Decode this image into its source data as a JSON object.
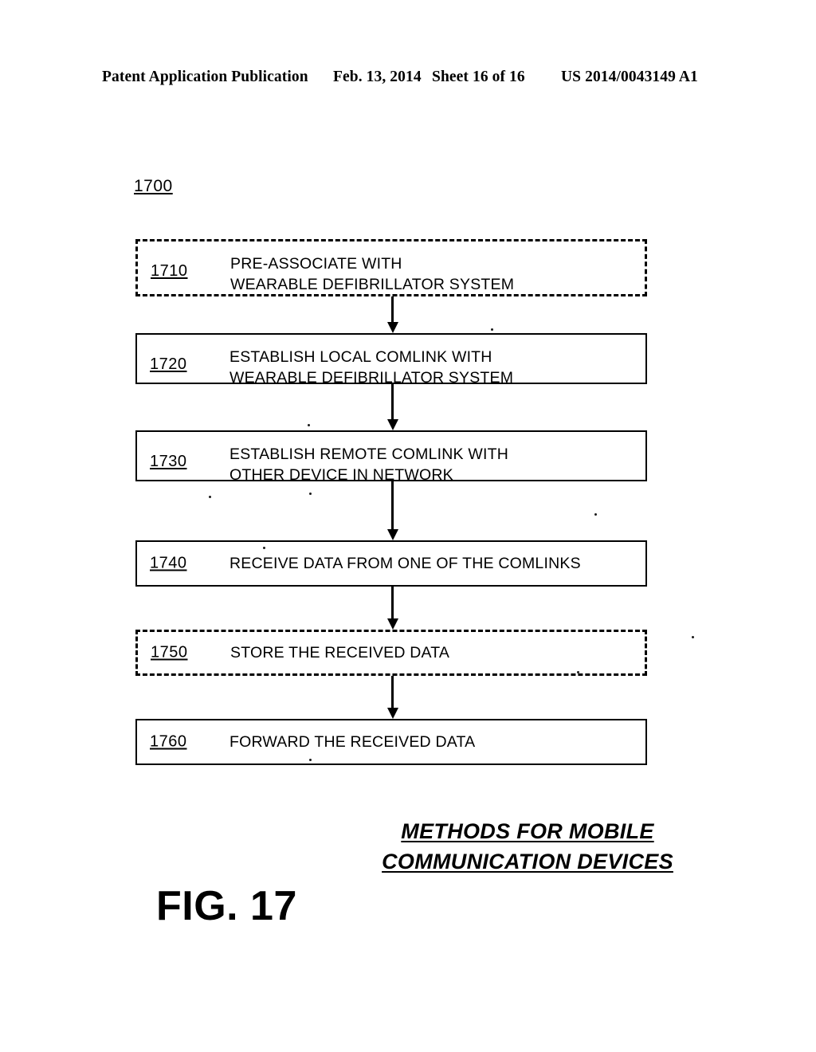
{
  "header": {
    "publication": "Patent Application Publication",
    "date": "Feb. 13, 2014",
    "sheet": "Sheet 16 of 16",
    "document_number": "US 2014/0043149 A1"
  },
  "figure": {
    "root_reference": "1700",
    "number": "FIG. 17",
    "caption_line_1": "METHODS FOR MOBILE",
    "caption_line_2": "COMMUNICATION DEVICES"
  },
  "flowchart": {
    "type": "flowchart",
    "orientation": "top-to-bottom",
    "steps": [
      {
        "ref": "1710",
        "label": "PRE-ASSOCIATE WITH\nWEARABLE DEFIBRILLATOR SYSTEM",
        "border": "dashed",
        "lines": 2
      },
      {
        "ref": "1720",
        "label": "ESTABLISH LOCAL COMLINK WITH\nWEARABLE DEFIBRILLATOR SYSTEM",
        "border": "solid",
        "lines": 2
      },
      {
        "ref": "1730",
        "label": "ESTABLISH REMOTE COMLINK WITH\nOTHER DEVICE IN NETWORK",
        "border": "solid",
        "lines": 2
      },
      {
        "ref": "1740",
        "label": "RECEIVE DATA FROM ONE OF THE COMLINKS",
        "border": "solid",
        "lines": 1
      },
      {
        "ref": "1750",
        "label": "STORE THE RECEIVED DATA",
        "border": "dashed",
        "lines": 1
      },
      {
        "ref": "1760",
        "label": "FORWARD THE RECEIVED DATA",
        "border": "solid",
        "lines": 1
      }
    ]
  },
  "colors": {
    "ink": "#000000",
    "paper": "#ffffff"
  }
}
